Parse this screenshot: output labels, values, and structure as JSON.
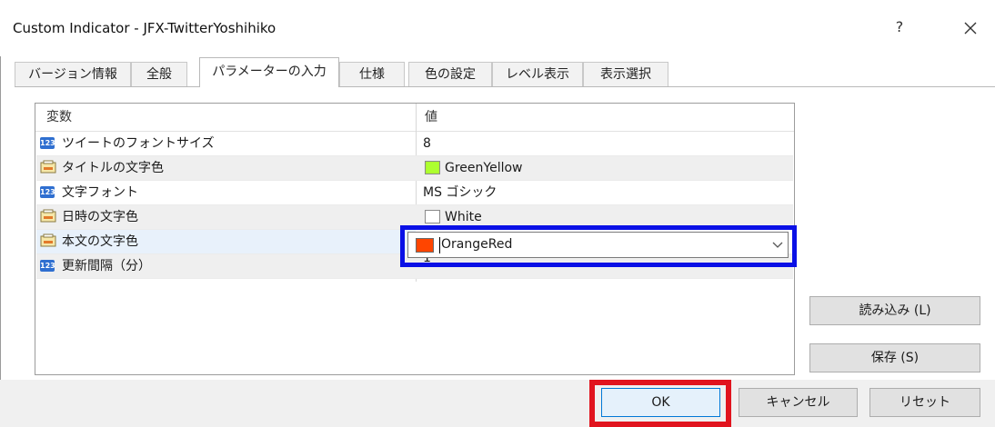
{
  "window": {
    "title": "Custom Indicator - JFX-TwitterYoshihiko",
    "help": "?",
    "close": "✕"
  },
  "tabs": [
    {
      "label": "バージョン情報",
      "active": false
    },
    {
      "label": "全般",
      "active": false
    },
    {
      "label": "パラメーターの入力",
      "active": true
    },
    {
      "label": "仕様",
      "active": false
    },
    {
      "label": "色の設定",
      "active": false
    },
    {
      "label": "レベル表示",
      "active": false
    },
    {
      "label": "表示選択",
      "active": false
    }
  ],
  "grid": {
    "header_name": "変数",
    "header_value": "値",
    "rows": [
      {
        "icon": "number-type-icon",
        "icon_text": "123",
        "name": "ツイートのフォントサイズ",
        "value": "8",
        "swatch": ""
      },
      {
        "icon": "color-type-icon",
        "name": "タイトルの文字色",
        "value": "GreenYellow",
        "swatch": "#adff2f"
      },
      {
        "icon": "number-type-icon",
        "icon_text": "123",
        "name": "文字フォント",
        "value": "MS ゴシック",
        "swatch": ""
      },
      {
        "icon": "color-type-icon",
        "name": "日時の文字色",
        "value": "White",
        "swatch": "#ffffff"
      },
      {
        "icon": "color-type-icon",
        "name": "本文の文字色",
        "value": "OrangeRed",
        "swatch": "#ff4500",
        "selected": true
      },
      {
        "icon": "number-type-icon",
        "icon_text": "123",
        "name": "更新間隔（分）",
        "value": "1",
        "swatch": ""
      }
    ]
  },
  "editor": {
    "value": "OrangeRed",
    "swatch": "#ff4500"
  },
  "buttons": {
    "load": "読み込み (L)",
    "save": "保存 (S)",
    "ok": "OK",
    "cancel": "キャンセル",
    "reset": "リセット"
  },
  "highlight_colors": {
    "editor_highlight": "#0a10e6",
    "ok_highlight": "#e1141e"
  }
}
